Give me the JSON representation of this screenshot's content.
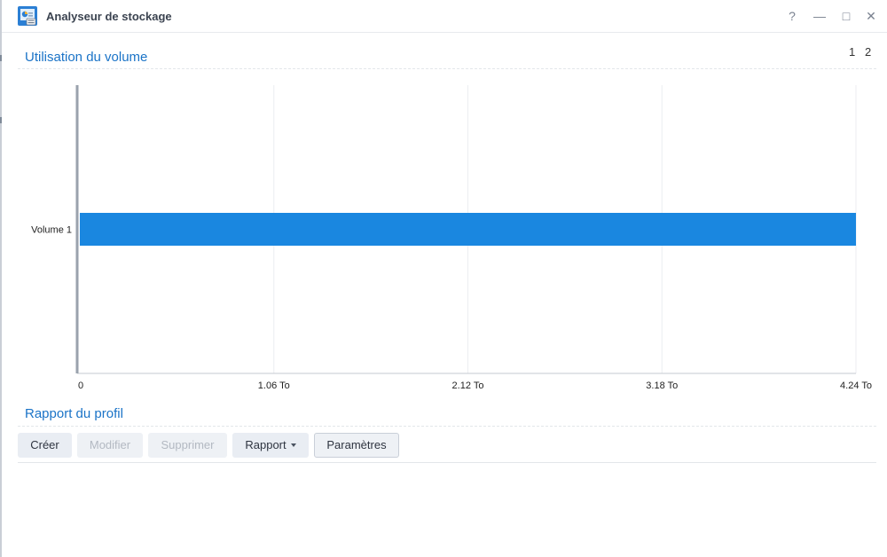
{
  "window": {
    "title": "Analyseur de stockage",
    "help_glyph": "?",
    "minimize_glyph": "—",
    "maximize_glyph": "□",
    "close_glyph": "✕"
  },
  "usage_section": {
    "title": "Utilisation du volume",
    "pages": [
      "1",
      "2"
    ]
  },
  "chart_data": {
    "type": "bar",
    "orientation": "horizontal",
    "categories": [
      "Volume 1"
    ],
    "values": [
      4.24
    ],
    "unit": "To",
    "xlim": [
      0,
      4.24
    ],
    "tick_labels": [
      "0",
      "1.06 To",
      "2.12 To",
      "3.18 To",
      "4.24 To"
    ],
    "grid": true,
    "bar_color": "#1a87e0"
  },
  "report_section": {
    "title": "Rapport du profil"
  },
  "toolbar": {
    "create_label": "Créer",
    "modify_label": "Modifier",
    "delete_label": "Supprimer",
    "report_label": "Rapport",
    "settings_label": "Paramètres"
  }
}
